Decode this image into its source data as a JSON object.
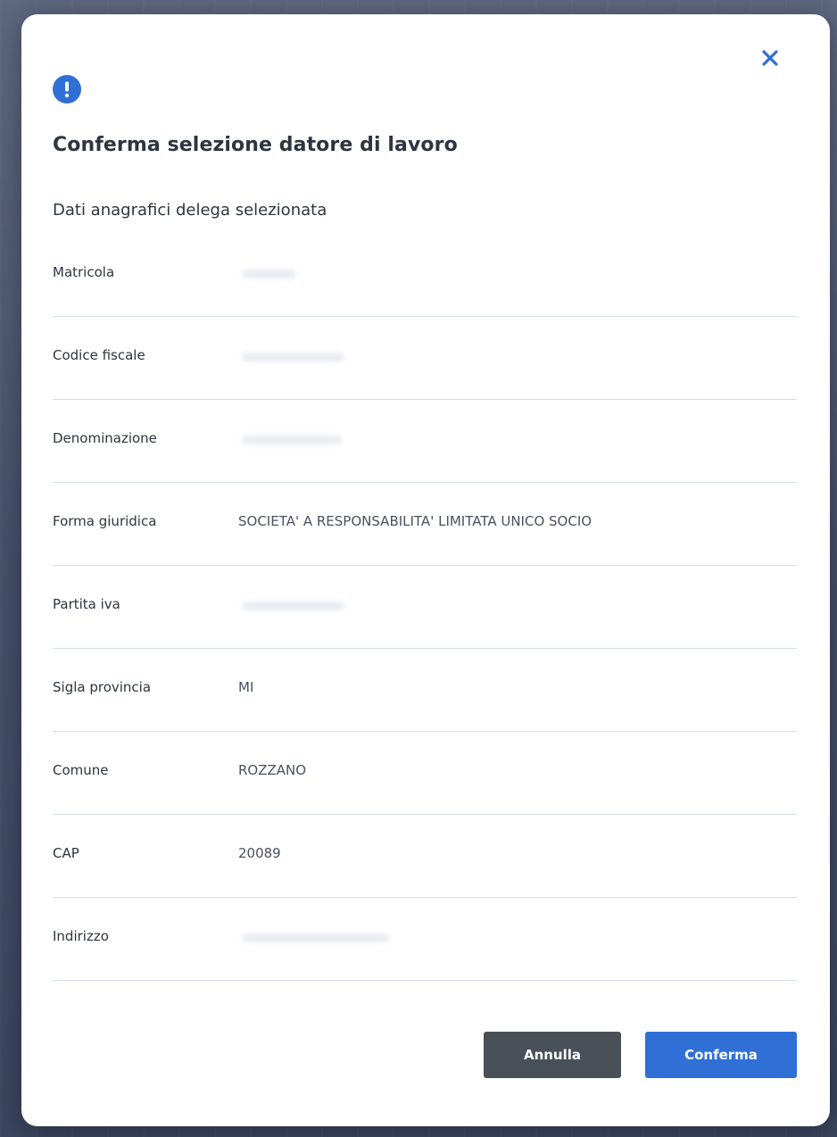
{
  "dialog": {
    "title": "Conferma selezione datore di lavoro",
    "subtitle": "Dati anagrafici delega selezionata",
    "fields": [
      {
        "label": "Matricola",
        "value": ""
      },
      {
        "label": "Codice fiscale",
        "value": ""
      },
      {
        "label": "Denominazione",
        "value": ""
      },
      {
        "label": "Forma giuridica",
        "value": "SOCIETA' A RESPONSABILITA' LIMITATA UNICO SOCIO"
      },
      {
        "label": "Partita iva",
        "value": ""
      },
      {
        "label": "Sigla provincia",
        "value": "MI"
      },
      {
        "label": "Comune",
        "value": "ROZZANO"
      },
      {
        "label": "CAP",
        "value": "20089"
      },
      {
        "label": "Indirizzo",
        "value": ""
      }
    ],
    "buttons": {
      "cancel_label": "Annulla",
      "confirm_label": "Conferma"
    }
  },
  "colors": {
    "accent": "#2f6fd6",
    "cancel_button": "#4a5058",
    "divider": "#d3dfeb",
    "text": "#2e3440"
  },
  "icons": {
    "alert": "exclamation-circle-icon",
    "close": "close-icon"
  }
}
